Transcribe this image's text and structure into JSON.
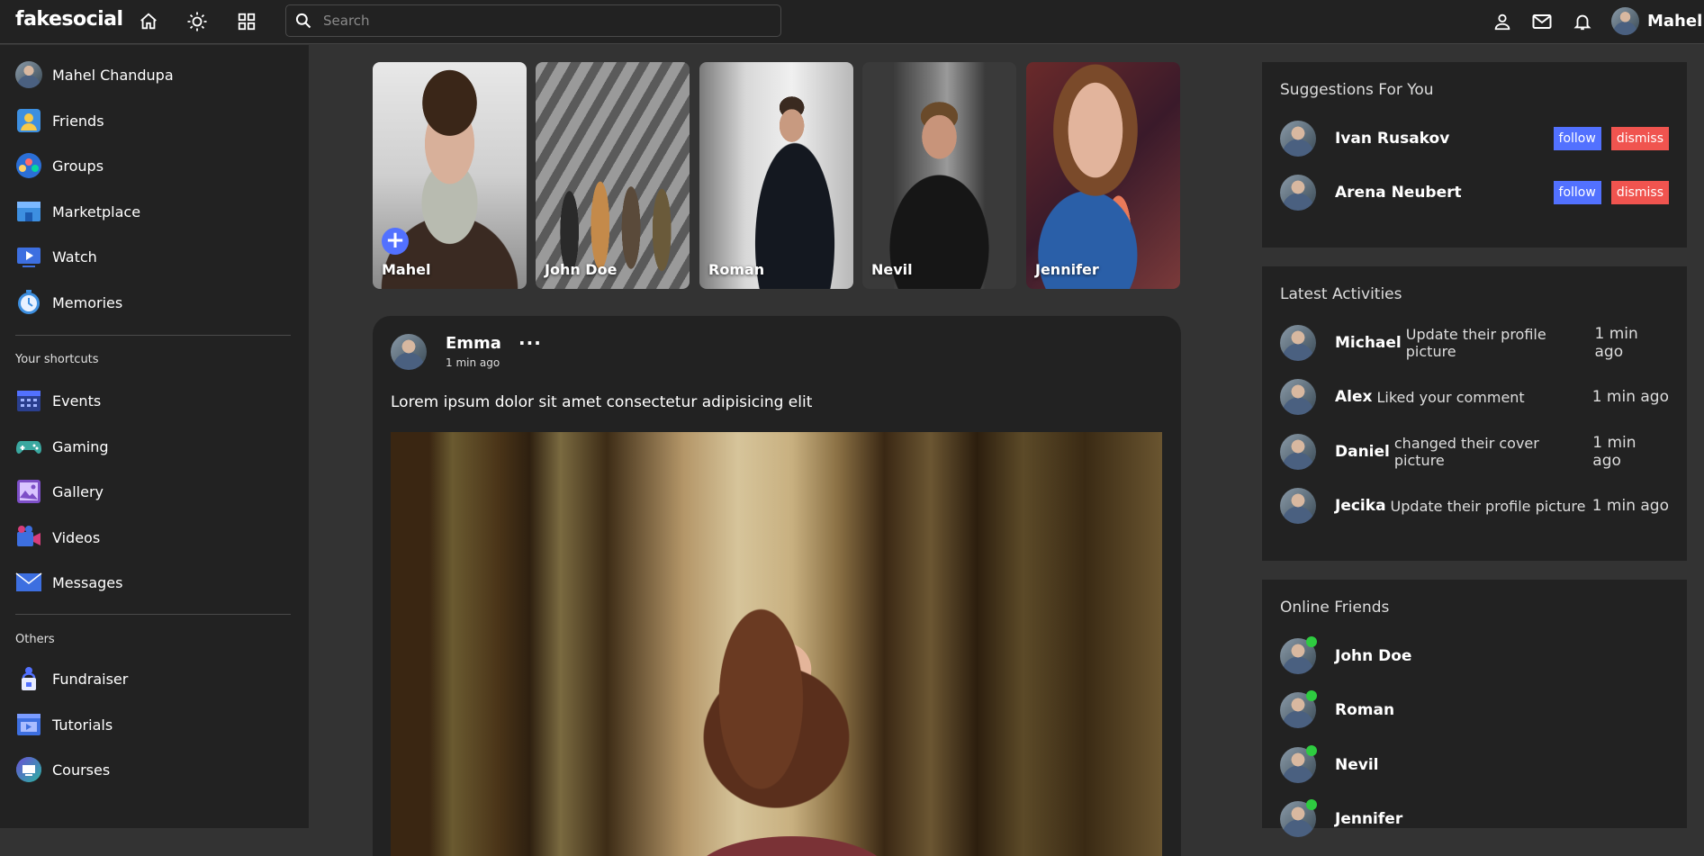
{
  "navbar": {
    "logo": "fakesocial",
    "search_placeholder": "Search",
    "user_name": "Mahel"
  },
  "leftbar": {
    "profile_name": "Mahel Chandupa",
    "main_items": [
      {
        "label": "Friends"
      },
      {
        "label": "Groups"
      },
      {
        "label": "Marketplace"
      },
      {
        "label": "Watch"
      },
      {
        "label": "Memories"
      }
    ],
    "shortcuts_title": "Your shortcuts",
    "shortcut_items": [
      {
        "label": "Events"
      },
      {
        "label": "Gaming"
      },
      {
        "label": "Gallery"
      },
      {
        "label": "Videos"
      },
      {
        "label": "Messages"
      }
    ],
    "others_title": "Others",
    "other_items": [
      {
        "label": "Fundraiser"
      },
      {
        "label": "Tutorials"
      },
      {
        "label": "Courses"
      }
    ]
  },
  "stories": [
    {
      "name": "Mahel",
      "add": "+"
    },
    {
      "name": "John Doe"
    },
    {
      "name": "Roman"
    },
    {
      "name": "Nevil"
    },
    {
      "name": "Jennifer"
    }
  ],
  "post": {
    "author": "Emma",
    "time": "1 min ago",
    "more": "···",
    "text": "Lorem ipsum dolor sit amet consectetur adipisicing elit"
  },
  "suggestions": {
    "title": "Suggestions For You",
    "follow_label": "follow",
    "dismiss_label": "dismiss",
    "users": [
      {
        "name": "Ivan Rusakov"
      },
      {
        "name": "Arena Neubert"
      }
    ]
  },
  "activities": {
    "title": "Latest Activities",
    "items": [
      {
        "name": "Michael",
        "action": "Update their profile picture",
        "time": "1 min ago"
      },
      {
        "name": "Alex",
        "action": "Liked your comment",
        "time": "1 min ago"
      },
      {
        "name": "Daniel",
        "action": "changed their cover picture",
        "time": "1 min ago"
      },
      {
        "name": "Jecika",
        "action": "Update their profile picture",
        "time": "1 min ago"
      }
    ]
  },
  "online": {
    "title": "Online Friends",
    "friends": [
      {
        "name": "John Doe"
      },
      {
        "name": "Roman"
      },
      {
        "name": "Nevil"
      },
      {
        "name": "Jennifer"
      }
    ]
  },
  "colors": {
    "accent": "#5271ff",
    "dismiss": "#f0544f",
    "online": "#2ecc40",
    "panel": "#222222",
    "background": "#333333"
  }
}
